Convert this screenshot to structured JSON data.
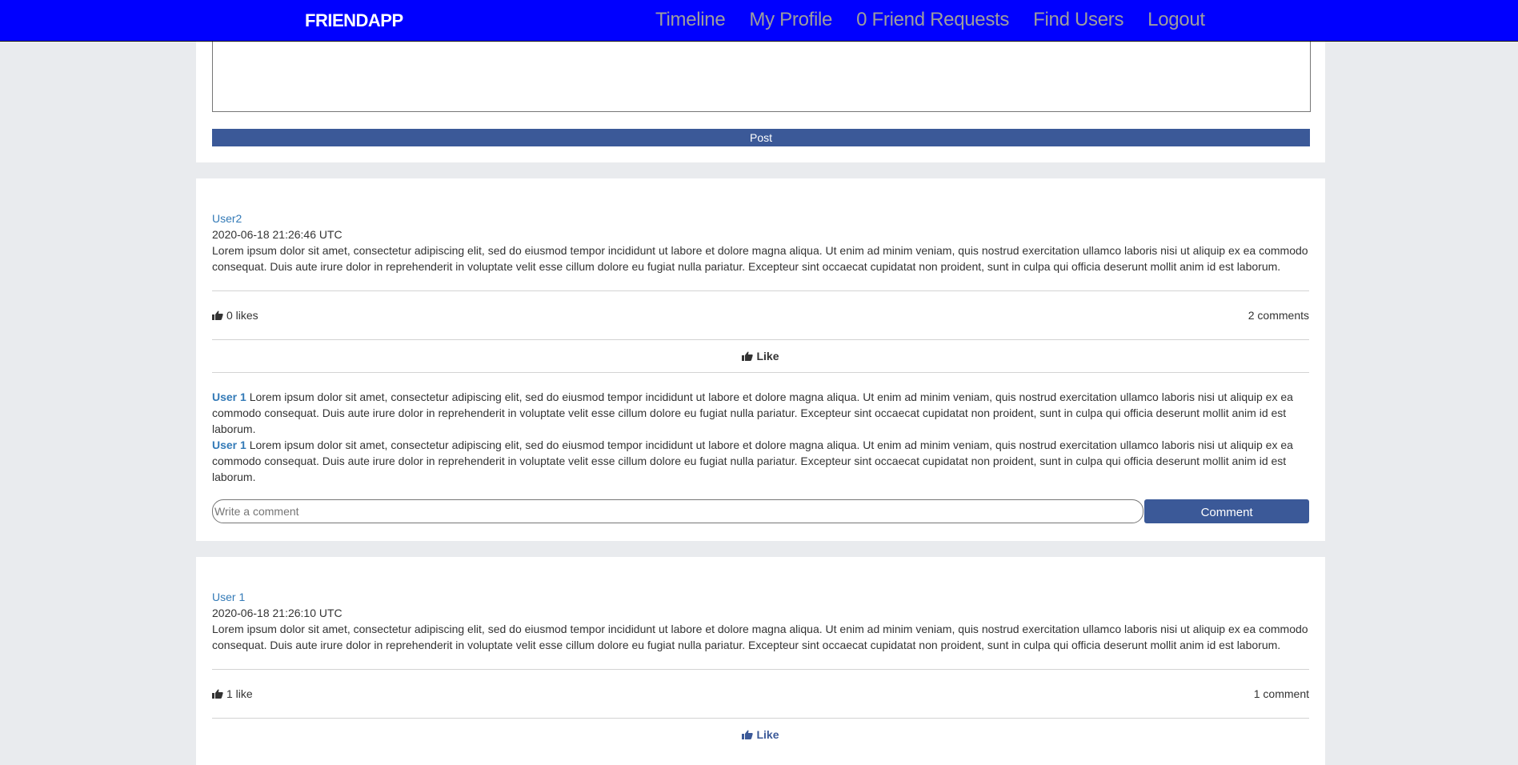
{
  "navbar": {
    "brand": "FRIENDAPP",
    "bg_color": "#0000ff",
    "links": [
      {
        "label": "Timeline"
      },
      {
        "label": "My Profile"
      },
      {
        "label": "0 Friend Requests"
      },
      {
        "label": "Find Users"
      },
      {
        "label": "Logout"
      }
    ]
  },
  "composer": {
    "textarea_value": "",
    "post_button": "Post"
  },
  "accent_color": "#3b5998",
  "link_color": "#337ab7",
  "posts": [
    {
      "author": "User2",
      "timestamp": "2020-06-18 21:26:46 UTC",
      "body": "Lorem ipsum dolor sit amet, consectetur adipiscing elit, sed do eiusmod tempor incididunt ut labore et dolore magna aliqua. Ut enim ad minim veniam, quis nostrud exercitation ullamco laboris nisi ut aliquip ex ea commodo consequat. Duis aute irure dolor in reprehenderit in voluptate velit esse cillum dolore eu fugiat nulla pariatur. Excepteur sint occaecat cupidatat non proident, sunt in culpa qui officia deserunt mollit anim id est laborum.",
      "likes_label": "0 likes",
      "comments_label": "2 comments",
      "like_button": "Like",
      "liked": false,
      "comments": [
        {
          "author": "User 1",
          "text": "Lorem ipsum dolor sit amet, consectetur adipiscing elit, sed do eiusmod tempor incididunt ut labore et dolore magna aliqua. Ut enim ad minim veniam, quis nostrud exercitation ullamco laboris nisi ut aliquip ex ea commodo consequat. Duis aute irure dolor in reprehenderit in voluptate velit esse cillum dolore eu fugiat nulla pariatur. Excepteur sint occaecat cupidatat non proident, sunt in culpa qui officia deserunt mollit anim id est laborum."
        },
        {
          "author": "User 1",
          "text": "Lorem ipsum dolor sit amet, consectetur adipiscing elit, sed do eiusmod tempor incididunt ut labore et dolore magna aliqua. Ut enim ad minim veniam, quis nostrud exercitation ullamco laboris nisi ut aliquip ex ea commodo consequat. Duis aute irure dolor in reprehenderit in voluptate velit esse cillum dolore eu fugiat nulla pariatur. Excepteur sint occaecat cupidatat non proident, sunt in culpa qui officia deserunt mollit anim id est laborum."
        }
      ],
      "comment_placeholder": "Write a comment",
      "comment_button": "Comment"
    },
    {
      "author": "User 1",
      "timestamp": "2020-06-18 21:26:10 UTC",
      "body": "Lorem ipsum dolor sit amet, consectetur adipiscing elit, sed do eiusmod tempor incididunt ut labore et dolore magna aliqua. Ut enim ad minim veniam, quis nostrud exercitation ullamco laboris nisi ut aliquip ex ea commodo consequat. Duis aute irure dolor in reprehenderit in voluptate velit esse cillum dolore eu fugiat nulla pariatur. Excepteur sint occaecat cupidatat non proident, sunt in culpa qui officia deserunt mollit anim id est laborum.",
      "likes_label": "1 like",
      "comments_label": "1 comment",
      "like_button": "Like",
      "liked": true
    }
  ]
}
